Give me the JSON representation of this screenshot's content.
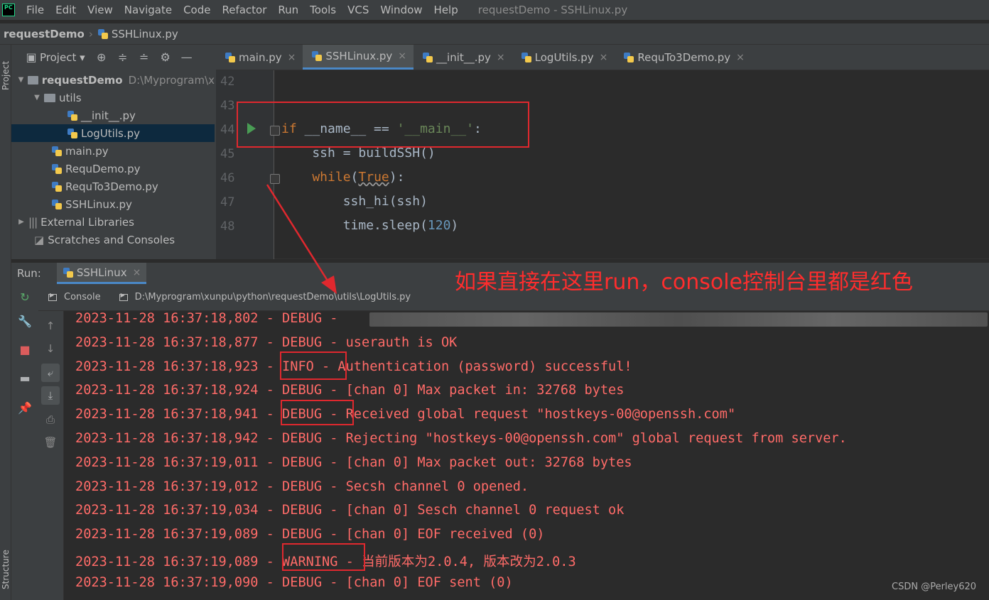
{
  "app": {
    "logo_text": "PC",
    "window_title": "requestDemo - SSHLinux.py"
  },
  "menu": [
    "File",
    "Edit",
    "View",
    "Navigate",
    "Code",
    "Refactor",
    "Run",
    "Tools",
    "VCS",
    "Window",
    "Help"
  ],
  "breadcrumb": {
    "project": "requestDemo",
    "file": "SSHLinux.py"
  },
  "left_strip": {
    "project_label": "Project",
    "structure_label": "Structure"
  },
  "project_panel": {
    "title": "Project",
    "tree": [
      {
        "label": "requestDemo",
        "path": "D:\\Myprogram\\x",
        "type": "folder",
        "depth": 0,
        "expanded": true
      },
      {
        "label": "utils",
        "type": "folder",
        "depth": 1,
        "expanded": true
      },
      {
        "label": "__init__.py",
        "type": "py",
        "depth": 2
      },
      {
        "label": "LogUtils.py",
        "type": "py",
        "depth": 2,
        "selected": true
      },
      {
        "label": "main.py",
        "type": "py",
        "depth": 1
      },
      {
        "label": "RequDemo.py",
        "type": "py",
        "depth": 1
      },
      {
        "label": "RequTo3Demo.py",
        "type": "py",
        "depth": 1
      },
      {
        "label": "SSHLinux.py",
        "type": "py",
        "depth": 1
      },
      {
        "label": "External Libraries",
        "type": "lib",
        "depth": 0,
        "expanded": false
      },
      {
        "label": "Scratches and Consoles",
        "type": "scratch",
        "depth": 0
      }
    ]
  },
  "editor_tabs": [
    {
      "label": "main.py",
      "active": false
    },
    {
      "label": "SSHLinux.py",
      "active": true
    },
    {
      "label": "__init__.py",
      "active": false
    },
    {
      "label": "LogUtils.py",
      "active": false
    },
    {
      "label": "RequTo3Demo.py",
      "active": false
    }
  ],
  "code": {
    "line_numbers": [
      "42",
      "43",
      "44",
      "45",
      "46",
      "47",
      "48"
    ],
    "lines": {
      "l44_kw": "if",
      "l44_mid": " __name__ == ",
      "l44_str": "'__main__'",
      "l44_end": ":",
      "l45": "    ssh = buildSSH()",
      "l46_kw": "    while",
      "l46_open": "(",
      "l46_true": "True",
      "l46_close": "):",
      "l47": "        ssh_hi(ssh)",
      "l48_a": "        time.sleep(",
      "l48_num": "120",
      "l48_b": ")"
    }
  },
  "run_panel": {
    "label": "Run:",
    "tab": "SSHLinux",
    "console_tab": "Console",
    "path_tab": "D:\\Myprogram\\xunpu\\python\\requestDemo\\utils\\LogUtils.py"
  },
  "annotation": "如果直接在这里run，console控制台里都是红色",
  "console_lines": [
    "2023-11-28 16:37:18,802 - DEBUG -",
    "2023-11-28 16:37:18,877 - DEBUG - userauth is OK",
    "2023-11-28 16:37:18,923 - INFO - Authentication (password) successful!",
    "2023-11-28 16:37:18,924 - DEBUG - [chan 0] Max packet in: 32768 bytes",
    "2023-11-28 16:37:18,941 - DEBUG - Received global request \"hostkeys-00@openssh.com\"",
    "2023-11-28 16:37:18,942 - DEBUG - Rejecting \"hostkeys-00@openssh.com\" global request from server.",
    "2023-11-28 16:37:19,011 - DEBUG - [chan 0] Max packet out: 32768 bytes",
    "2023-11-28 16:37:19,012 - DEBUG - Secsh channel 0 opened.",
    "2023-11-28 16:37:19,034 - DEBUG - [chan 0] Sesch channel 0 request ok",
    "2023-11-28 16:37:19,089 - DEBUG - [chan 0] EOF received (0)",
    "2023-11-28 16:37:19,089 - WARNING - 当前版本为2.0.4, 版本改为2.0.3",
    "2023-11-28 16:37:19,090 - DEBUG - [chan 0] EOF sent (0)"
  ],
  "watermark": "CSDN @Perley620",
  "colors": {
    "annotation_red": "#e0282e",
    "log_red": "#ff6b68",
    "keyword": "#cc7832",
    "string": "#6a8759",
    "number": "#6897bb",
    "active_tab_underline": "#4a88c7"
  }
}
